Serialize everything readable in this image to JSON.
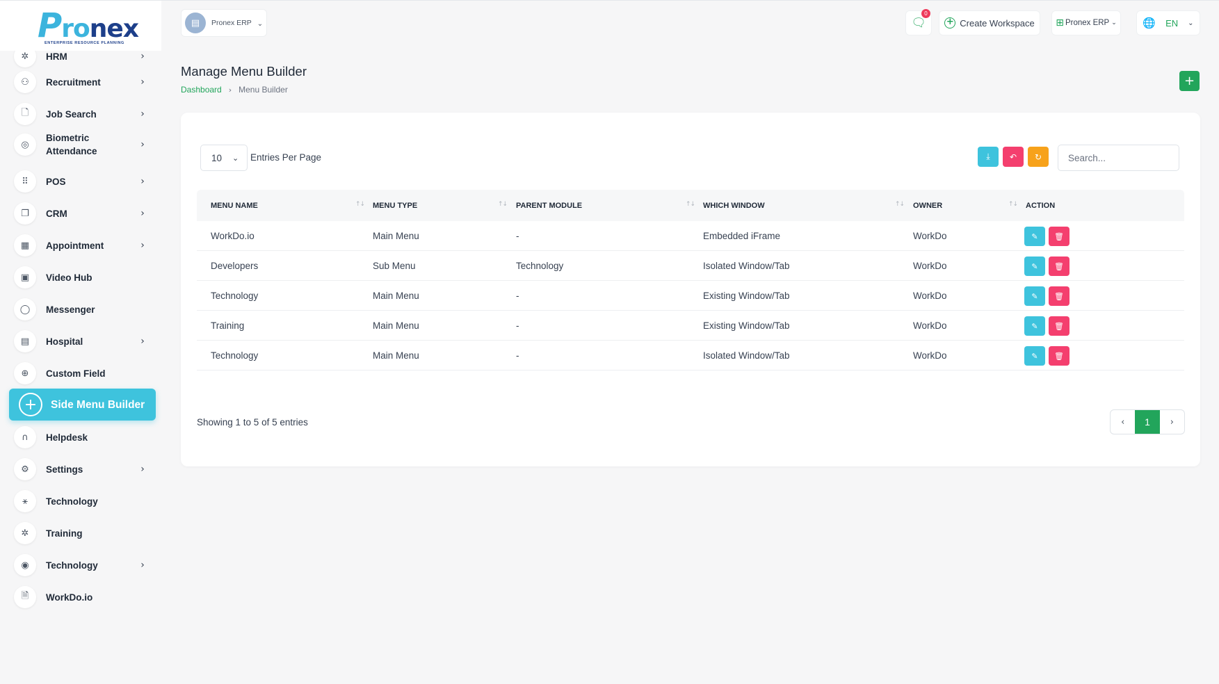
{
  "brand": {
    "logo_p": "P",
    "logo_ro": "ro",
    "logo_nex": "nex",
    "tagline": "ENTERPRISE RESOURCE PLANNING"
  },
  "sidebar": {
    "items": [
      {
        "label": "HRM",
        "icon": "hrm-icon",
        "glyph": "✲",
        "has_arrow": true
      },
      {
        "label": "Recruitment",
        "icon": "user-plus-icon",
        "glyph": "⚇",
        "has_arrow": true
      },
      {
        "label": "Job Search",
        "icon": "document-search-icon",
        "glyph": "🗋",
        "has_arrow": true
      },
      {
        "label": "Biometric\nAttendance",
        "icon": "fingerprint-icon",
        "glyph": "◎",
        "has_arrow": true
      },
      {
        "label": "POS",
        "icon": "grid-icon",
        "glyph": "⠿",
        "has_arrow": true
      },
      {
        "label": "CRM",
        "icon": "copy-icon",
        "glyph": "❐",
        "has_arrow": true
      },
      {
        "label": "Appointment",
        "icon": "calendar-icon",
        "glyph": "▦",
        "has_arrow": true
      },
      {
        "label": "Video Hub",
        "icon": "video-icon",
        "glyph": "▣",
        "has_arrow": false
      },
      {
        "label": "Messenger",
        "icon": "message-icon",
        "glyph": "◯",
        "has_arrow": false
      },
      {
        "label": "Hospital",
        "icon": "hospital-icon",
        "glyph": "▤",
        "has_arrow": true
      },
      {
        "label": "Custom Field",
        "icon": "plus-circle-icon",
        "glyph": "⊕",
        "has_arrow": false
      },
      {
        "label": "Side Menu Builder",
        "icon": "plus-circle-icon",
        "glyph": "+",
        "has_arrow": false,
        "active": true
      },
      {
        "label": "Helpdesk",
        "icon": "headphones-icon",
        "glyph": "∩",
        "has_arrow": false
      },
      {
        "label": "Settings",
        "icon": "gear-icon",
        "glyph": "⚙",
        "has_arrow": true
      },
      {
        "label": "Technology",
        "icon": "network-icon",
        "glyph": "⚹",
        "has_arrow": false
      },
      {
        "label": "Training",
        "icon": "hrm-icon",
        "glyph": "✲",
        "has_arrow": false
      },
      {
        "label": "Technology",
        "icon": "broadcast-icon",
        "glyph": "◉",
        "has_arrow": true
      },
      {
        "label": "WorkDo.io",
        "icon": "document-icon",
        "glyph": "🗎",
        "has_arrow": false
      }
    ]
  },
  "header": {
    "workspace_name": "Pronex ERP",
    "notification_count": "0",
    "create_workspace": "Create Workspace",
    "app_switcher": "Pronex ERP",
    "language": "EN"
  },
  "page": {
    "title": "Manage Menu Builder",
    "breadcrumb_home": "Dashboard",
    "breadcrumb_current": "Menu Builder"
  },
  "table_controls": {
    "per_page_value": "10",
    "per_page_label": "Entries Per Page",
    "search_placeholder": "Search..."
  },
  "table": {
    "columns": [
      "MENU NAME",
      "MENU TYPE",
      "PARENT MODULE",
      "WHICH WINDOW",
      "OWNER",
      "ACTION"
    ],
    "rows": [
      [
        "WorkDo.io",
        "Main Menu",
        "-",
        "Embedded iFrame",
        "WorkDo"
      ],
      [
        "Developers",
        "Sub Menu",
        "Technology",
        "Isolated Window/Tab",
        "WorkDo"
      ],
      [
        "Technology",
        "Main Menu",
        "-",
        "Existing Window/Tab",
        "WorkDo"
      ],
      [
        "Training",
        "Main Menu",
        "-",
        "Existing Window/Tab",
        "WorkDo"
      ],
      [
        "Technology",
        "Main Menu",
        "-",
        "Isolated Window/Tab",
        "WorkDo"
      ]
    ]
  },
  "footer": {
    "showing_text": "Showing 1 to 5 of 5 entries",
    "current_page": "1"
  },
  "colors": {
    "accent_green": "#22a55b",
    "active_cyan": "#3ec3dd",
    "danger_pink": "#f43f6e",
    "warning_orange": "#f7a21b"
  }
}
